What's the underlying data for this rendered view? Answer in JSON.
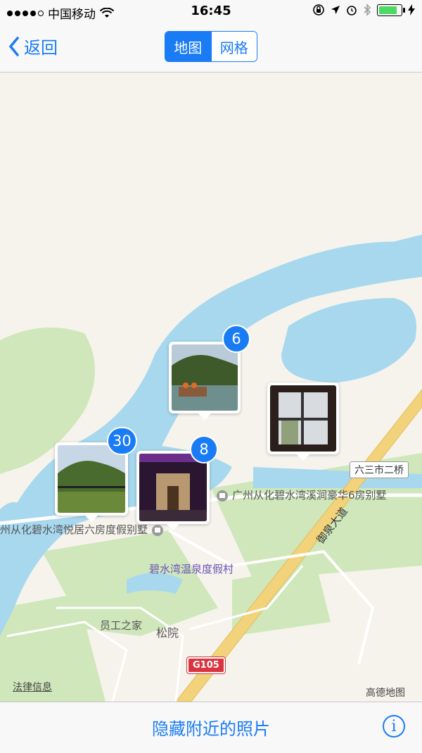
{
  "status_bar": {
    "carrier": "中国移动",
    "time": "16:45",
    "icons": [
      "signal-dots",
      "wifi-icon",
      "orientation-lock-icon",
      "location-icon",
      "alarm-icon",
      "bluetooth-icon",
      "battery-icon",
      "charging-icon"
    ],
    "battery_level": 0.9
  },
  "nav": {
    "back_label": "返回",
    "segments": [
      "地图",
      "网格"
    ],
    "selected_segment": "地图"
  },
  "map": {
    "clusters": [
      {
        "count": "6",
        "scene": "lake-boats"
      },
      {
        "count": "30",
        "scene": "mountain-fence"
      },
      {
        "count": "8",
        "scene": "hotel-entrance"
      },
      {
        "count": "",
        "scene": "window-view"
      }
    ],
    "labels": {
      "villa_1": "广州从化碧水湾溪涧豪华6房别墅",
      "villa_2": "州从化碧水湾悦居六房度假别墅",
      "resort": "碧水湾温泉度假村",
      "staff_home": "员工之家",
      "songyuan": "松院",
      "road": "御泉大道",
      "bridge": "六三市二桥",
      "highway": "G105",
      "legal": "法律信息",
      "provider": "高德地图"
    }
  },
  "toolbar": {
    "hide_nearby": "隐藏附近的照片",
    "info_icon": "info-icon"
  },
  "colors": {
    "accent": "#1a7cf5",
    "water": "#a7d8ee",
    "park": "#cfe7bb",
    "land": "#f6f3ec",
    "road": "#f2d27a"
  }
}
